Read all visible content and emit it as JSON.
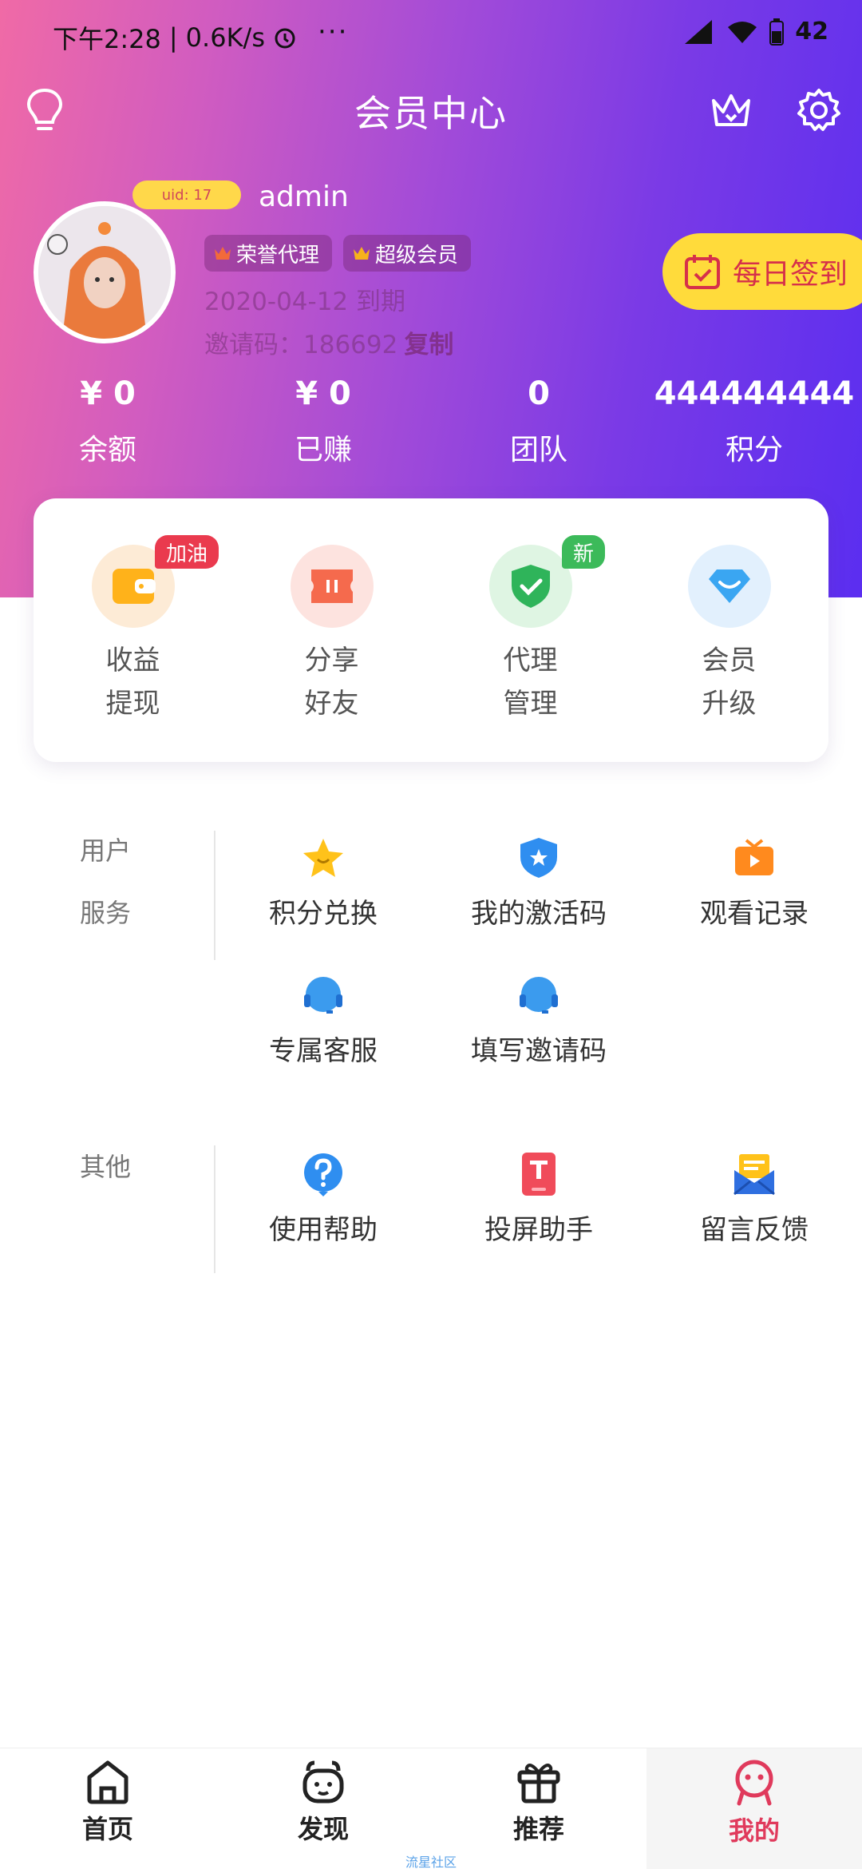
{
  "status_bar": {
    "time": "下午2:28",
    "speed": "0.6K/s",
    "dots": "···",
    "battery": "42"
  },
  "header": {
    "title": "会员中心"
  },
  "profile": {
    "uid_badge": "uid: 17",
    "username": "admin",
    "tags": [
      "荣誉代理",
      "超级会员"
    ],
    "expiry": "2020-04-12 到期",
    "invite_label": "邀请码：186692",
    "invite_copy": "复制"
  },
  "signin_button": "每日签到",
  "stats": [
    {
      "value": "¥ 0",
      "label": "余额"
    },
    {
      "value": "¥ 0",
      "label": "已赚"
    },
    {
      "value": "0",
      "label": "团队"
    },
    {
      "value": "444444444",
      "label": "积分"
    }
  ],
  "quick_actions": [
    {
      "line1": "收益",
      "line2": "提现",
      "badge": "加油",
      "icon": "wallet-icon"
    },
    {
      "line1": "分享",
      "line2": "好友",
      "badge": "",
      "icon": "ticket-icon"
    },
    {
      "line1": "代理",
      "line2": "管理",
      "badge": "新",
      "icon": "shield-check-icon"
    },
    {
      "line1": "会员",
      "line2": "升级",
      "badge": "",
      "icon": "diamond-icon"
    }
  ],
  "user_service": {
    "label_line1": "用户",
    "label_line2": "服务",
    "items": [
      {
        "label": "积分兑换",
        "icon": "star-icon"
      },
      {
        "label": "我的激活码",
        "icon": "shield-star-icon"
      },
      {
        "label": "观看记录",
        "icon": "tv-play-icon"
      },
      {
        "label": "专属客服",
        "icon": "headset-icon"
      },
      {
        "label": "填写邀请码",
        "icon": "headset-icon"
      }
    ]
  },
  "other": {
    "label": "其他",
    "items": [
      {
        "label": "使用帮助",
        "icon": "help-icon"
      },
      {
        "label": "投屏助手",
        "icon": "cast-icon"
      },
      {
        "label": "留言反馈",
        "icon": "mail-feedback-icon"
      }
    ]
  },
  "bottom_nav": [
    {
      "label": "首页",
      "icon": "home-icon"
    },
    {
      "label": "发现",
      "icon": "discover-icon"
    },
    {
      "label": "推荐",
      "icon": "gift-icon"
    },
    {
      "label": "我的",
      "icon": "profile-face-icon"
    }
  ],
  "footer_note": "流星社区",
  "colors": {
    "accent_pink": "#e03a5c",
    "signin_yellow": "#ffdb3b",
    "gradient_start": "#f06aa6",
    "gradient_end": "#5b2ef0"
  }
}
